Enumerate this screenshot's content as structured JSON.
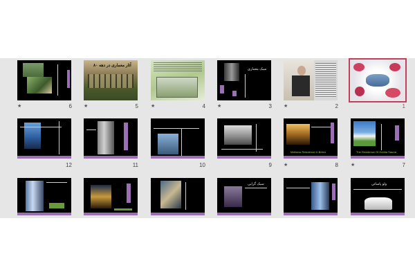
{
  "slide_sorter": {
    "slides": [
      {
        "number": "1",
        "has_transition": false,
        "selected": true
      },
      {
        "number": "2",
        "has_transition": true,
        "selected": false
      },
      {
        "number": "3",
        "has_transition": true,
        "selected": false
      },
      {
        "number": "4",
        "has_transition": true,
        "selected": false
      },
      {
        "number": "5",
        "has_transition": true,
        "selected": false
      },
      {
        "number": "6",
        "has_transition": true,
        "selected": false
      },
      {
        "number": "7",
        "has_transition": true,
        "selected": false
      },
      {
        "number": "8",
        "has_transition": true,
        "selected": false
      },
      {
        "number": "9",
        "has_transition": false,
        "selected": false
      },
      {
        "number": "10",
        "has_transition": false,
        "selected": false
      },
      {
        "number": "11",
        "has_transition": false,
        "selected": false
      },
      {
        "number": "12",
        "has_transition": false,
        "selected": false
      }
    ],
    "transition_symbol": "★",
    "slide_texts": {
      "s3_title": "سبک معماری",
      "s5_title": "آثار معماری در دهه ۸۰",
      "s7_caption": "The Residence Of Hubba Sauna",
      "s8_caption": "Mattress Residence in Belen",
      "s13_title": "ولو پاسائی",
      "s15_title": "سبک گرایی"
    }
  },
  "colors": {
    "accent_purple": "#9b6fb3",
    "selection": "#c0405a",
    "slide_bg": "#000000",
    "sorter_bg": "#e6e6e6"
  }
}
